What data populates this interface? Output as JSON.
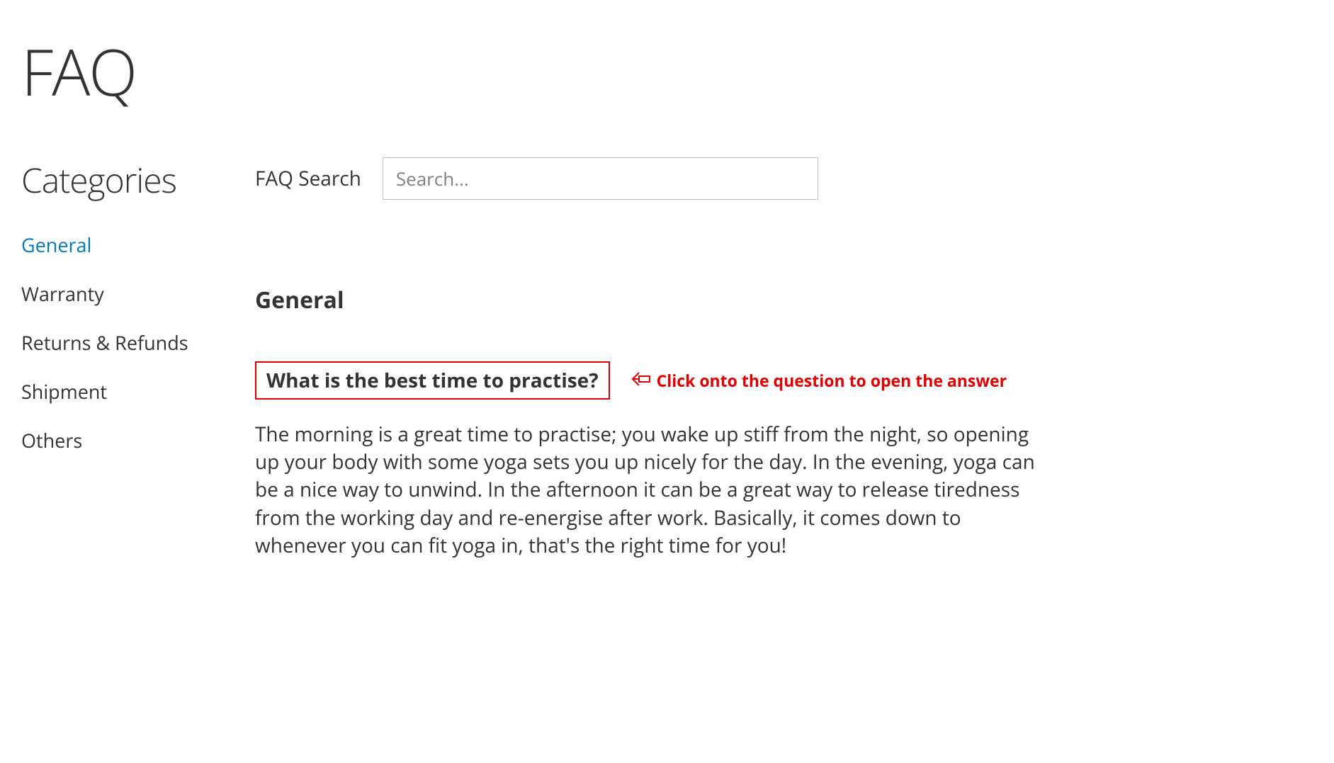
{
  "page": {
    "title": "FAQ"
  },
  "sidebar": {
    "title": "Categories",
    "items": [
      {
        "label": "General",
        "active": true
      },
      {
        "label": "Warranty",
        "active": false
      },
      {
        "label": "Returns & Refunds",
        "active": false
      },
      {
        "label": "Shipment",
        "active": false
      },
      {
        "label": "Others",
        "active": false
      }
    ]
  },
  "search": {
    "label": "FAQ Search",
    "placeholder": "Search..."
  },
  "section": {
    "heading": "General"
  },
  "faq": {
    "question": "What is the best time to practise?",
    "answer": "The morning is a great time to practise; you wake up stiff from the night, so opening up your body with some yoga sets you up nicely for the day. In the evening, yoga can be a nice way to unwind. In the afternoon it can be a great way to release tiredness from the working day and re-energise after work. Basically, it comes down to whenever you can fit yoga in, that's the right time for you!"
  },
  "annotation": {
    "text": "Click onto the question to open the answer"
  }
}
